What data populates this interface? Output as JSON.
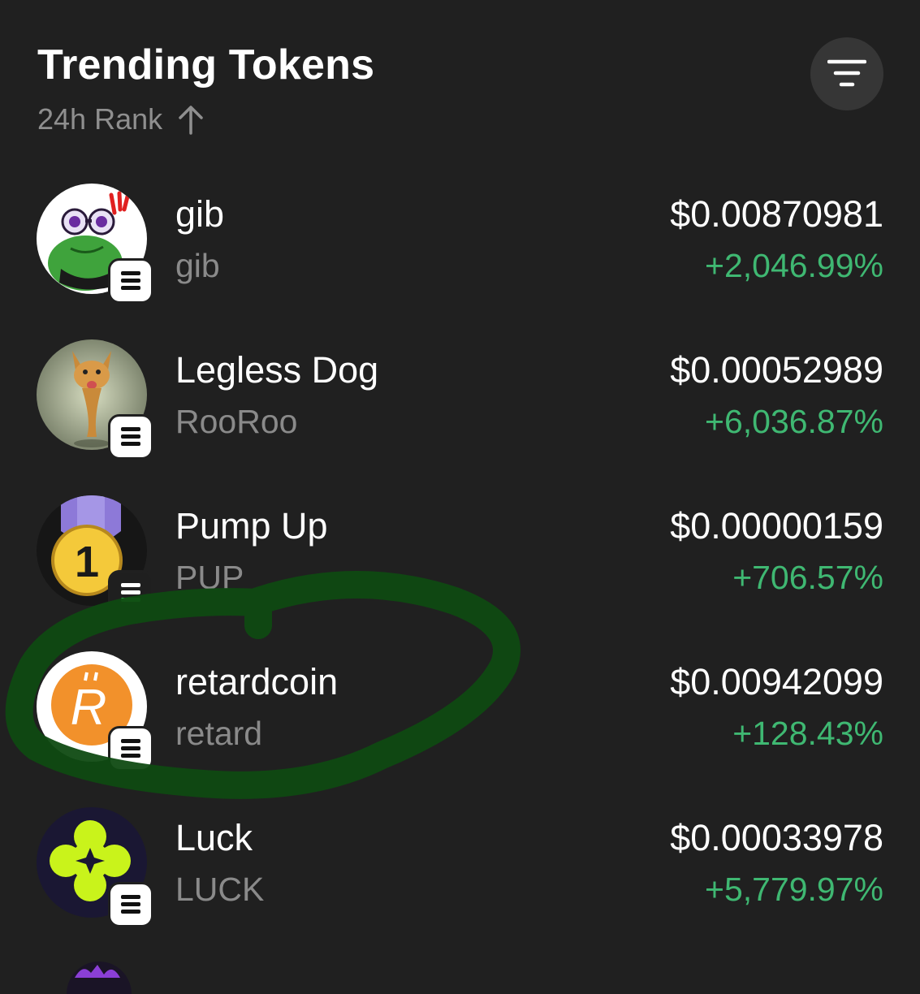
{
  "header": {
    "title": "Trending Tokens",
    "sort_label": "24h Rank",
    "sort_direction_icon": "arrow-up-icon",
    "filter_icon": "filter-lines-icon"
  },
  "tokens": [
    {
      "name": "gib",
      "symbol": "gib",
      "price": "$0.00870981",
      "change": "+2,046.99%",
      "avatar_icon": "frog-avatar-icon",
      "chain_icon": "solana-icon"
    },
    {
      "name": "Legless Dog",
      "symbol": "RooRoo",
      "price": "$0.00052989",
      "change": "+6,036.87%",
      "avatar_icon": "dog-avatar-icon",
      "chain_icon": "solana-icon"
    },
    {
      "name": "Pump Up",
      "symbol": "PUP",
      "price": "$0.00000159",
      "change": "+706.57%",
      "avatar_icon": "medal-avatar-icon",
      "avatar_text": "1",
      "chain_icon": "solana-icon"
    },
    {
      "name": "retardcoin",
      "symbol": "retard",
      "price": "$0.00942099",
      "change": "+128.43%",
      "avatar_icon": "r-coin-avatar-icon",
      "avatar_text": "R",
      "chain_icon": "solana-icon"
    },
    {
      "name": "Luck",
      "symbol": "LUCK",
      "price": "$0.00033978",
      "change": "+5,779.97%",
      "avatar_icon": "clover-avatar-icon",
      "chain_icon": "solana-icon"
    }
  ],
  "colors": {
    "background": "#202020",
    "positive": "#3fb872",
    "muted": "#8a8a8a",
    "highlight_circle": "#0f4a12"
  }
}
